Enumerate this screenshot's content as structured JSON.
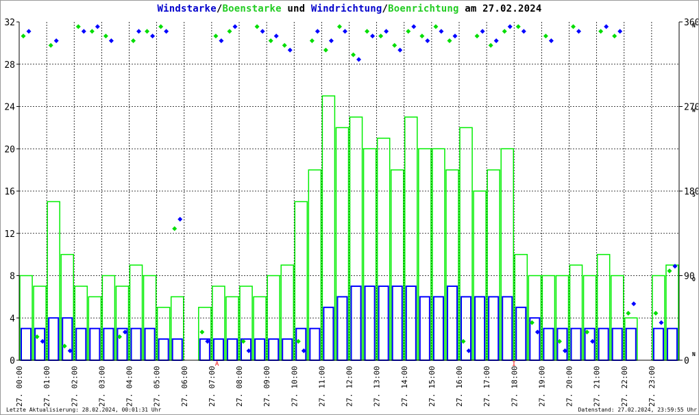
{
  "title": {
    "part1": "Windstarke",
    "sep1": "/",
    "part2": "Boenstarke",
    "mid": " und ",
    "part3": "Windrichtung",
    "sep2": "/",
    "part4": "Boenrichtung",
    "tail": " am 27.02.2024"
  },
  "footer": {
    "left": "Letzte Aktualisierung: 28.02.2024, 00:01:31 Uhr",
    "right": "Datenstand: 27.02.2024, 23:59:55 Uhr"
  },
  "colors": {
    "wind": "#0000ff",
    "gust": "#00ee00",
    "wind_dir": "#0000ff",
    "gust_dir": "#00dd00"
  },
  "chart_data": {
    "type": "bar",
    "title": "Windstarke/Boenstarke und Windrichtung/Boenrichtung am 27.02.2024",
    "x_labels": [
      "27. 00:00",
      "27. 01:00",
      "27. 02:00",
      "27. 03:00",
      "27. 04:00",
      "27. 05:00",
      "27. 06:00",
      "27. 07:00",
      "27. 08:00",
      "27. 09:00",
      "27. 10:00",
      "27. 11:00",
      "27. 12:00",
      "27. 13:00",
      "27. 14:00",
      "27. 15:00",
      "27. 16:00",
      "27. 17:00",
      "27. 18:00",
      "27. 19:00",
      "27. 20:00",
      "27. 21:00",
      "27. 22:00",
      "27. 23:00"
    ],
    "ylim": [
      0,
      32
    ],
    "y_ticks": [
      0,
      4,
      8,
      12,
      16,
      20,
      24,
      28,
      32
    ],
    "y2lim": [
      0,
      360
    ],
    "y2_ticks": [
      {
        "v": 0,
        "l": "0",
        "c": "N"
      },
      {
        "v": 90,
        "l": "90",
        "c": "O"
      },
      {
        "v": 180,
        "l": "180",
        "c": "S"
      },
      {
        "v": 270,
        "l": "270",
        "c": "W"
      },
      {
        "v": 360,
        "l": "360",
        "c": "N"
      }
    ],
    "grid": true,
    "x_hours_per_sample": 0.5,
    "series": [
      {
        "name": "Windstarke",
        "values": [
          3,
          3,
          4,
          4,
          3,
          3,
          3,
          3,
          3,
          3,
          2,
          2,
          null,
          2,
          2,
          2,
          2,
          2,
          2,
          2,
          3,
          3,
          5,
          6,
          7,
          7,
          7,
          7,
          7,
          6,
          6,
          7,
          6,
          6,
          6,
          6,
          5,
          4,
          3,
          3,
          3,
          3,
          3,
          3,
          3,
          null,
          3,
          3
        ]
      },
      {
        "name": "Boenstarke",
        "values": [
          8,
          7,
          15,
          10,
          7,
          6,
          8,
          7,
          9,
          8,
          5,
          6,
          null,
          5,
          7,
          6,
          7,
          6,
          8,
          9,
          15,
          18,
          25,
          22,
          23,
          20,
          21,
          18,
          23,
          20,
          20,
          18,
          22,
          16,
          18,
          20,
          10,
          8,
          8,
          8,
          9,
          8,
          10,
          8,
          4,
          null,
          8,
          9
        ]
      },
      {
        "name": "Windrichtung",
        "values": [
          350,
          20,
          340,
          10,
          350,
          355,
          340,
          30,
          350,
          345,
          350,
          150,
          null,
          20,
          340,
          355,
          10,
          350,
          345,
          330,
          10,
          350,
          340,
          350,
          320,
          345,
          350,
          330,
          355,
          340,
          350,
          345,
          10,
          350,
          340,
          355,
          350,
          30,
          340,
          10,
          350,
          20,
          355,
          350,
          60,
          null,
          40,
          100
        ]
      },
      {
        "name": "Boenrichtung",
        "values": [
          345,
          25,
          335,
          15,
          355,
          350,
          345,
          25,
          340,
          350,
          355,
          140,
          null,
          30,
          345,
          350,
          20,
          355,
          340,
          335,
          20,
          340,
          330,
          355,
          325,
          350,
          345,
          335,
          350,
          345,
          355,
          340,
          20,
          345,
          335,
          350,
          355,
          40,
          345,
          20,
          355,
          30,
          350,
          345,
          50,
          null,
          50,
          95
        ]
      }
    ],
    "markers": [
      {
        "hour": 7.2,
        "label": "A"
      },
      {
        "hour": 18.0,
        "label": "I"
      }
    ]
  }
}
